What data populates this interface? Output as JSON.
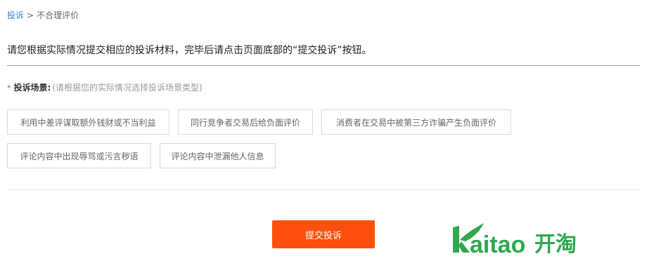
{
  "breadcrumb": {
    "root": "投诉",
    "separator": ">",
    "current": "不合理评价"
  },
  "instruction": "请您根据实际情况提交相应的投诉材料，完毕后请点击页面底部的“提交投诉”按钮。",
  "scene": {
    "required_mark": "*",
    "title": "投诉场景:",
    "hint": "(请根据您的实际情况选择投诉场景类型)",
    "options": [
      "利用中差评谋取额外钱财或不当利益",
      "同行竞争者交易后给负面评价",
      "消费者在交易中被第三方诈骗产生负面评价",
      "评论内容中出现辱骂或污言秽语",
      "评论内容中泄漏他人信息"
    ]
  },
  "submit_label": "提交投诉",
  "logo": {
    "text_latin": "Kaitao",
    "text_cn": "开淘",
    "color": "#2fa84f"
  },
  "colors": {
    "link": "#3d7fcc",
    "submit_bg": "#ff4f0e",
    "required": "#e4393c"
  }
}
